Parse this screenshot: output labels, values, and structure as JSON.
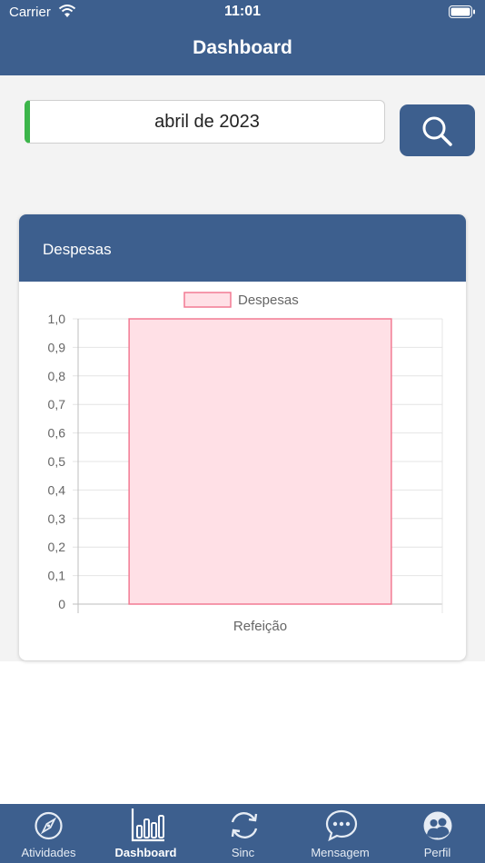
{
  "status_bar": {
    "carrier": "Carrier",
    "time": "11:01"
  },
  "nav": {
    "title": "Dashboard"
  },
  "filter": {
    "month": "abril de 2023"
  },
  "card": {
    "title": "Despesas"
  },
  "chart_data": {
    "type": "bar",
    "categories": [
      "Refeição"
    ],
    "series": [
      {
        "name": "Despesas",
        "values": [
          1.0
        ]
      }
    ],
    "ylim": [
      0,
      1.0
    ],
    "yticks": [
      "0",
      "0,1",
      "0,2",
      "0,3",
      "0,4",
      "0,5",
      "0,6",
      "0,7",
      "0,8",
      "0,9",
      "1,0"
    ],
    "grid": true,
    "legend": "top",
    "colors": {
      "bar_fill": "#ffe0e6",
      "bar_stroke": "#f27a93"
    }
  },
  "tabs": [
    {
      "label": "Atividades",
      "icon": "compass-icon",
      "active": false
    },
    {
      "label": "Dashboard",
      "icon": "bar-chart-icon",
      "active": true
    },
    {
      "label": "Sinc",
      "icon": "sync-icon",
      "active": false
    },
    {
      "label": "Mensagem",
      "icon": "message-icon",
      "active": false
    },
    {
      "label": "Perfil",
      "icon": "profile-icon",
      "active": false
    }
  ],
  "colors": {
    "primary": "#3d5f8e",
    "accent_green": "#3cb54a",
    "background": "#f3f3f3"
  }
}
